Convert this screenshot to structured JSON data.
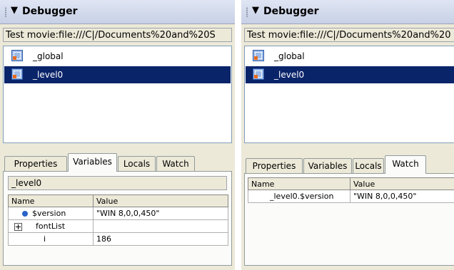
{
  "left": {
    "title": "Debugger",
    "movie": "Test movie:file:///C|/Documents%20and%20S",
    "tree": [
      "_global",
      "_level0"
    ],
    "tabs": [
      "Properties",
      "Variables",
      "Locals",
      "Watch"
    ],
    "active_tab": "Variables",
    "scope": "_level0",
    "columns": [
      "Name",
      "Value"
    ],
    "rows": [
      {
        "name": "$version",
        "value": "\"WIN 8,0,0,450\""
      },
      {
        "name": "fontList",
        "value": ""
      },
      {
        "name": "i",
        "value": "186"
      }
    ]
  },
  "right": {
    "title": "Debugger",
    "movie": "Test movie:file:///C|/Documents%20and%20",
    "tree": [
      "_global",
      "_level0"
    ],
    "tabs": [
      "Properties",
      "Variables",
      "Locals",
      "Watch"
    ],
    "active_tab": "Watch",
    "columns": [
      "Name",
      "Value"
    ],
    "rows": [
      {
        "name": "_level0.$version",
        "value": "\"WIN 8,0,0,450\""
      }
    ]
  },
  "colors": {
    "selection": "#0a246a",
    "panel_bg": "#ece9d8",
    "title_bg": "#dfe5f3"
  },
  "icons": [
    "expand-arrow-icon",
    "movieclip-icon",
    "variable-bullet-icon",
    "expand-plus-icon"
  ]
}
